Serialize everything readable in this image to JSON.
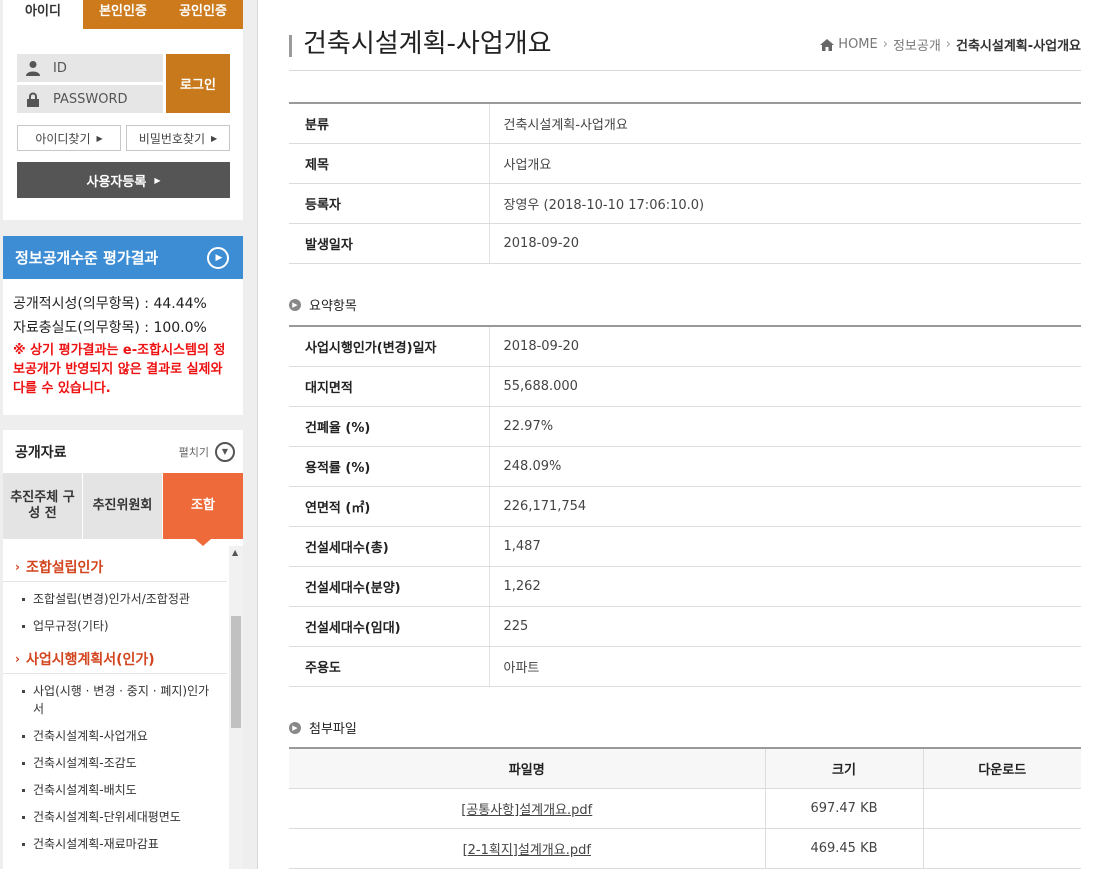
{
  "sidebar": {
    "login": {
      "tabs": [
        "아이디",
        "본인인증",
        "공인인증"
      ],
      "id_placeholder": "ID",
      "password_placeholder": "PASSWORD",
      "login_label": "로그인",
      "find_id_label": "아이디찾기",
      "find_pw_label": "비밀번호찾기",
      "register_label": "사용자등록"
    },
    "eval": {
      "title": "정보공개수준 평가결과",
      "line1": "공개적시성(의무항목) : 44.44%",
      "line2": "자료충실도(의무항목) : 100.0%",
      "warning": "※ 상기 평가결과는 e-조합시스템의 정보공개가 반영되지 않은 결과로 실제와 다를 수 있습니다."
    },
    "open_data": {
      "title": "공개자료",
      "expand_label": "펼치기",
      "tabs": [
        "추진주체 구성 전",
        "추진위원회",
        "조합"
      ],
      "groups": [
        {
          "label": "조합설립인가",
          "items": [
            "조합설립(변경)인가서/조합정관",
            "업무규정(기타)"
          ]
        },
        {
          "label": "사업시행계획서(인가)",
          "items": [
            "사업(시행 · 변경 · 중지 · 폐지)인가서",
            "건축시설계획-사업개요",
            "건축시설계획-조감도",
            "건축시설계획-배치도",
            "건축시설계획-단위세대평면도",
            "건축시설계획-재료마감표"
          ]
        }
      ]
    }
  },
  "main": {
    "title": "건축시설계획-사업개요",
    "breadcrumb": {
      "home": "HOME",
      "level1": "정보공개",
      "current": "건축시설계획-사업개요"
    },
    "info": [
      {
        "key": "분류",
        "value": "건축시설계획-사업개요"
      },
      {
        "key": "제목",
        "value": "사업개요"
      },
      {
        "key": "등록자",
        "value": "장영우 (2018-10-10 17:06:10.0)"
      },
      {
        "key": "발생일자",
        "value": "2018-09-20"
      }
    ],
    "summary_label": "요약항목",
    "summary": [
      {
        "key": "사업시행인가(변경)일자",
        "value": "2018-09-20"
      },
      {
        "key": "대지면적",
        "value": "55,688.000"
      },
      {
        "key": "건폐율 (%)",
        "value": "22.97%"
      },
      {
        "key": "용적률 (%)",
        "value": "248.09%"
      },
      {
        "key": "연면적 (㎡)",
        "value": "226,171,754"
      },
      {
        "key": "건설세대수(총)",
        "value": "1,487"
      },
      {
        "key": "건설세대수(분양)",
        "value": "1,262"
      },
      {
        "key": "건설세대수(임대)",
        "value": "225"
      },
      {
        "key": "주용도",
        "value": "아파트"
      }
    ],
    "attach_label": "첨부파일",
    "files": {
      "headers": [
        "파일명",
        "크기",
        "다운로드"
      ],
      "rows": [
        {
          "name": "[공통사항]설계개요.pdf",
          "size": "697.47 KB"
        },
        {
          "name": "[2-1획지]설계개요.pdf",
          "size": "469.45 KB"
        }
      ]
    }
  },
  "colors": {
    "orange": "#cc7a1c",
    "blue": "#3d8dd4",
    "red": "#ee1111",
    "menu_orange": "#ee6a3a"
  }
}
